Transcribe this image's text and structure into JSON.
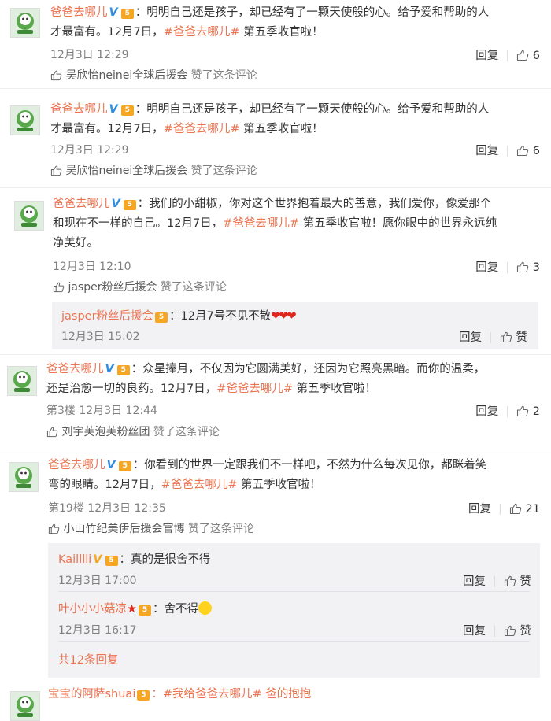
{
  "c1": {
    "user": "爸爸去哪儿",
    "text_a": "：明明自己还是孩子，却已经有了一颗天使般的心。给予爱和帮助的人",
    "text_b": "才最富有。12月7日，",
    "tag": "#爸爸去哪儿#",
    "text_c": " 第五季收官啦！",
    "time": "12月3日 12:29",
    "reply": "回复",
    "likes": "6",
    "liked_by": "吴欣怡neinei全球后援会",
    "liked_suffix": " 赞了这条评论"
  },
  "c2": {
    "user": "爸爸去哪儿",
    "text_a": "：明明自己还是孩子，却已经有了一颗天使般的心。给予爱和帮助的人",
    "text_b": "才最富有。12月7日，",
    "tag": "#爸爸去哪儿#",
    "text_c": " 第五季收官啦！",
    "time": "12月3日 12:29",
    "reply": "回复",
    "likes": "6",
    "liked_by": "吴欣怡neinei全球后援会",
    "liked_suffix": " 赞了这条评论"
  },
  "c3": {
    "user": "爸爸去哪儿",
    "text_a": "：我们的小甜椒，你对这个世界抱着最大的善意，我们爱你，像爱那个",
    "text_b": "和现在不一样的自己。12月7日，",
    "tag": "#爸爸去哪儿#",
    "text_c": " 第五季收官啦！愿你眼中的世界永远纯",
    "text_d": "净美好。",
    "time": "12月3日 12:10",
    "reply": "回复",
    "likes": "3",
    "liked_by": "jasper粉丝后援会",
    "liked_suffix": " 赞了这条评论",
    "sub": {
      "user": "jasper粉丝后援会",
      "text": "：12月7号不见不散",
      "hearts": "❤❤❤",
      "time": "12月3日 15:02",
      "reply": "回复",
      "like": "赞"
    }
  },
  "c4": {
    "user": "爸爸去哪儿",
    "text_a": "：众星捧月，不仅因为它圆满美好，还因为它照亮黑暗。而你的温柔，",
    "text_b": "还是治愈一切的良药。12月7日，",
    "tag": "#爸爸去哪儿#",
    "text_c": " 第五季收官啦！",
    "floor": "第3楼",
    "time": "12月3日 12:44",
    "reply": "回复",
    "likes": "2",
    "liked_by": "刘宇芙泡芙粉丝团",
    "liked_suffix": " 赞了这条评论"
  },
  "c5": {
    "user": "爸爸去哪儿",
    "text_a": "：你看到的世界一定跟我们不一样吧，不然为什么每次见你，都眯着笑",
    "text_b": "弯的眼睛。12月7日，",
    "tag": "#爸爸去哪儿#",
    "text_c": " 第五季收官啦！",
    "floor": "第19楼",
    "time": "12月3日 12:35",
    "reply": "回复",
    "likes": "21",
    "liked_by": "小山竹纪美伊后援会官博",
    "liked_suffix": " 赞了这条评论",
    "subs": [
      {
        "user": "Kailllli",
        "text": "：真的是很舍不得",
        "time": "12月3日 17:00",
        "reply": "回复",
        "like": "赞"
      },
      {
        "user": "叶小小小菇凉",
        "text": "：舍不得",
        "time": "12月3日 16:17",
        "reply": "回复",
        "like": "赞"
      }
    ],
    "more": "共12条回复"
  },
  "c6": {
    "user": "宝宝的阿萨shuai",
    "text": "：#我给爸爸去哪儿# 爸的抱抱"
  },
  "colors": {
    "accent": "#eb7350",
    "verified": "#2f8ee0",
    "meta": "#808080",
    "reply_bg": "#f2f2f5"
  },
  "icons": {
    "thumb": "thumb-up-icon",
    "verified": "verified-v-icon",
    "level": "member-level-icon"
  }
}
